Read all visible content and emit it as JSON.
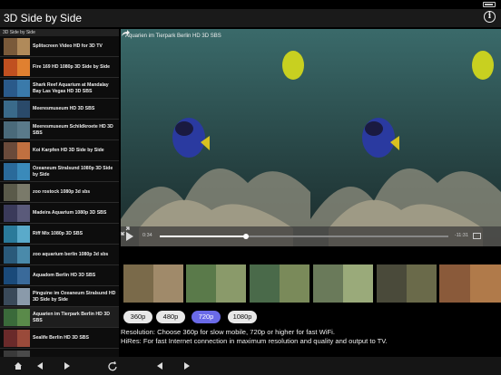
{
  "app": {
    "title": "3D Side by Side",
    "info_icon": "info-icon",
    "info_glyph": "i"
  },
  "sidebar": {
    "header": "3D Side by Side",
    "items": [
      {
        "label": "Splitscreen Video HD for 3D TV",
        "colors": [
          "#7a5a3a",
          "#b08a5a"
        ]
      },
      {
        "label": "Fire 169 HD 1080p 3D Side by Side",
        "colors": [
          "#c05020",
          "#e08030"
        ]
      },
      {
        "label": "Shark Reef Aquarium at Mandalay Bay Las Vegas HD 3D SBS",
        "colors": [
          "#2a5a8a",
          "#3a7aaa"
        ]
      },
      {
        "label": "Meeresmuseum HD 3D SBS",
        "colors": [
          "#3a6a8a",
          "#2a4a6a"
        ]
      },
      {
        "label": "Meeresmuseum Schildkroete HD 3D SBS",
        "colors": [
          "#4a6a7a",
          "#5a7a8a"
        ]
      },
      {
        "label": "Koi Karpfen HD 3D Side by Side",
        "colors": [
          "#6a4a3a",
          "#c07040"
        ]
      },
      {
        "label": "Ozeaneum Stralsund 1080p 3D Side by Side",
        "colors": [
          "#2a6a9a",
          "#3a8aba"
        ]
      },
      {
        "label": "zoo rostock 1080p 3d sbs",
        "colors": [
          "#5a5a4a",
          "#7a7a6a"
        ]
      },
      {
        "label": "Madeira Aquarium 1080p 3D SBS",
        "colors": [
          "#3a3a5a",
          "#5a5a7a"
        ]
      },
      {
        "label": "Riff Mix 1080p 3D SBS",
        "colors": [
          "#2a7a9a",
          "#5aaaca"
        ]
      },
      {
        "label": "zoo aquarium berlin 1080p 3d sbs",
        "colors": [
          "#2a5a7a",
          "#4a8aaa"
        ]
      },
      {
        "label": "Aquadom Berlin HD 3D SBS",
        "colors": [
          "#1a4a7a",
          "#3a6a9a"
        ]
      },
      {
        "label": "Pinguine im Ozeaneum Stralsund HD 3D Side by Side",
        "colors": [
          "#3a4a5a",
          "#8a9aaa"
        ]
      },
      {
        "label": "Aquarien im Tierpark Berlin HD 3D SBS",
        "colors": [
          "#3a6a3a",
          "#5a8a4a"
        ]
      },
      {
        "label": "Sealife Berlin HD 3D SBS",
        "colors": [
          "#6a2a2a",
          "#9a4a3a"
        ]
      },
      {
        "label": "",
        "colors": [
          "#3a3a3a",
          "#4a4a4a"
        ]
      }
    ]
  },
  "player": {
    "title": "Aquarien im Tierpark Berlin HD 3D SBS",
    "elapsed": "0:34",
    "remaining": "-11:31",
    "progress": 0.3,
    "share_icon": "share-icon",
    "play_icon": "play-icon",
    "fullscreen_icon": "fullscreen-icon"
  },
  "thumbnails": [
    {
      "colors": [
        "#7a6a4a",
        "#a08a6a"
      ]
    },
    {
      "colors": [
        "#5a7a4a",
        "#8a9a6a"
      ]
    },
    {
      "colors": [
        "#4a6a4a",
        "#7a8a5a"
      ]
    },
    {
      "colors": [
        "#6a7a5a",
        "#9aaa7a"
      ]
    },
    {
      "colors": [
        "#4a4a3a",
        "#6a6a4a"
      ]
    },
    {
      "colors": [
        "#8a5a3a",
        "#b07a4a"
      ]
    }
  ],
  "resolutions": {
    "options": [
      "360p",
      "480p",
      "720p",
      "1080p"
    ],
    "selected": "720p"
  },
  "info_text": {
    "line1": "Resolution: Choose 360p for slow mobile, 720p or higher for fast WiFi.",
    "line2": "HiRes: For fast Internet connection in maximum resolution and quality and output to TV."
  },
  "toolbar": {
    "home_icon": "home-icon",
    "back_icon": "back-icon",
    "forward_icon": "forward-icon",
    "reload_icon": "reload-icon",
    "player_back_icon": "player-back-icon",
    "player_forward_icon": "player-forward-icon"
  },
  "colors": {
    "accent": "#6a6ae8",
    "background": "#000000"
  }
}
